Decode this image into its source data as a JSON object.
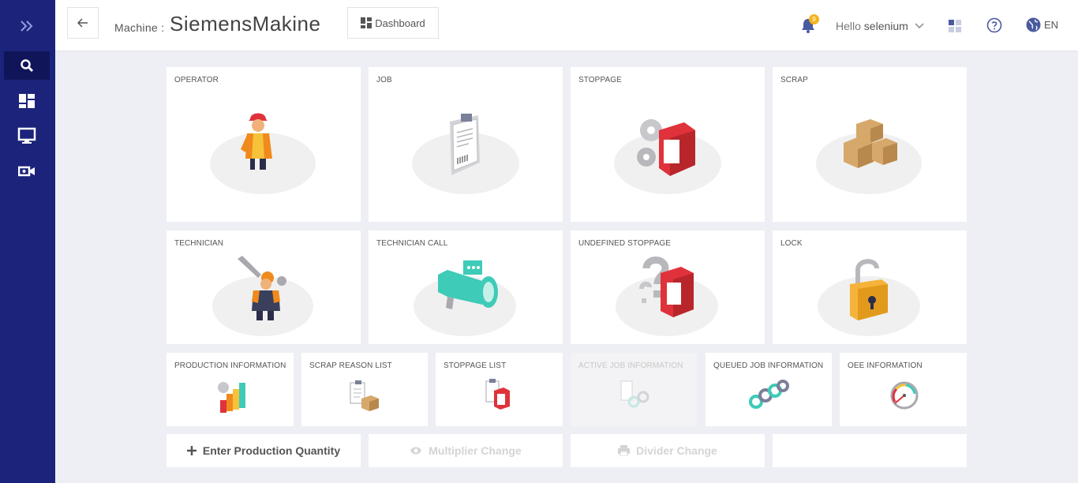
{
  "sidebar": {
    "items": [
      {
        "name": "expand-icon"
      },
      {
        "name": "search-icon"
      },
      {
        "name": "dashboard-icon"
      },
      {
        "name": "monitor-icon"
      },
      {
        "name": "camera-icon"
      }
    ]
  },
  "header": {
    "machine_label": "Machine :",
    "machine_name": "SiemensMakine",
    "dashboard_label": "Dashboard",
    "notification_count": "9",
    "greeting": "Hello",
    "username": "selenium",
    "language": "EN"
  },
  "cards_large": [
    {
      "title": "OPERATOR"
    },
    {
      "title": "JOB"
    },
    {
      "title": "STOPPAGE"
    },
    {
      "title": "SCRAP"
    },
    {
      "title": "TECHNICIAN"
    },
    {
      "title": "TECHNICIAN CALL"
    },
    {
      "title": "UNDEFINED STOPPAGE"
    },
    {
      "title": "LOCK"
    }
  ],
  "cards_small": [
    {
      "title": "PRODUCTION INFORMATION",
      "enabled": true
    },
    {
      "title": "SCRAP REASON LIST",
      "enabled": true
    },
    {
      "title": "STOPPAGE LIST",
      "enabled": true
    },
    {
      "title": "ACTIVE JOB INFORMATION",
      "enabled": false
    },
    {
      "title": "QUEUED JOB INFORMATION",
      "enabled": true
    },
    {
      "title": "OEE INFORMATION",
      "enabled": true
    }
  ],
  "actions": [
    {
      "label": "Enter Production Quantity",
      "enabled": true
    },
    {
      "label": "Multiplier Change",
      "enabled": false
    },
    {
      "label": "Divider Change",
      "enabled": false
    },
    {
      "label": "",
      "enabled": false
    }
  ],
  "colors": {
    "sidebar": "#1b237a",
    "sidebar_active": "#10155a",
    "background": "#eeeff4",
    "badge": "#f2b51f",
    "accent_red": "#e0323a",
    "accent_orange": "#f08a1d",
    "accent_teal": "#3ecbb8"
  }
}
